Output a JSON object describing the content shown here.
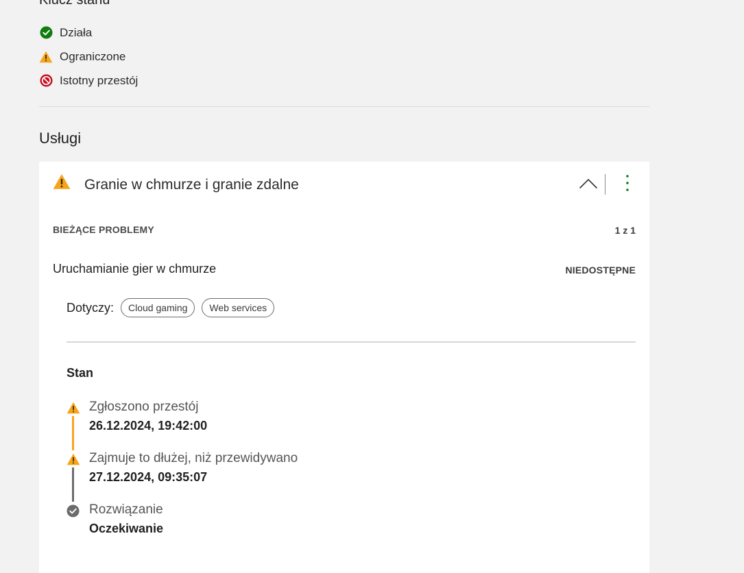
{
  "legend": {
    "title": "Klucz stanu",
    "items": [
      {
        "label": "Działa",
        "icon": "check-circle-icon",
        "color": "#107c10"
      },
      {
        "label": "Ograniczone",
        "icon": "warning-triangle-icon",
        "color": "#f7a41d"
      },
      {
        "label": "Istotny przestój",
        "icon": "blocked-circle-icon",
        "color": "#c50f1f"
      }
    ]
  },
  "services": {
    "title": "Usługi",
    "card": {
      "title": "Granie w chmurze i granie zdalne",
      "status_icon": "warning-triangle-icon",
      "accent_color": "#107c10",
      "current_issues_label": "BIEŻĄCE PROBLEMY",
      "pager": "1 z 1",
      "issue": {
        "title": "Uruchamianie gier w chmurze",
        "status": "NIEDOSTĘPNE",
        "affects_label": "Dotyczy:",
        "tags": [
          "Cloud gaming",
          "Web services"
        ],
        "stan_label": "Stan",
        "timeline": [
          {
            "text": "Zgłoszono przestój",
            "date": "26.12.2024, 19:42:00",
            "icon": "warning-triangle-icon",
            "line_color": "#f7a41d"
          },
          {
            "text": "Zajmuje to dłużej, niż przewidywano",
            "date": "27.12.2024, 09:35:07",
            "icon": "warning-triangle-icon",
            "line_color": "#6b6b6b"
          },
          {
            "text": "Rozwiązanie",
            "date": "Oczekiwanie",
            "icon": "check-circle-grey-icon",
            "line_color": ""
          }
        ]
      }
    }
  }
}
